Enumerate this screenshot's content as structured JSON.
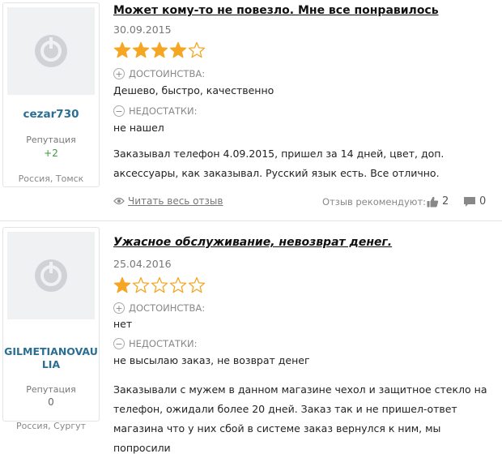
{
  "colors": {
    "username": "#2a6f93",
    "reputation_positive": "#3a9d3a",
    "star": "#f5a623",
    "muted": "#888888"
  },
  "labels": {
    "reputation": "Репутация",
    "pros": "ДОСТОИНСТВА:",
    "cons": "НЕДОСТАТКИ:",
    "read_full": "Читать весь отзыв",
    "recommended": "Отзыв рекомендуют:"
  },
  "reviews": [
    {
      "user": {
        "name": "cezar730",
        "reputation": "+2",
        "location": "Россия, Томск",
        "avatar_icon": "default-avatar-icon"
      },
      "title": "Может кому-то не повезло. Мне все понравилось",
      "date": "30.09.2015",
      "rating": 4,
      "rating_max": 5,
      "pros": "Дешево, быстро, качественно",
      "cons": "не нашел",
      "text_lines": [
        "Заказывал телефон 4.09.2015, пришел за 14 дней, цвет, доп.",
        "аксессуары, как заказывал. Русский язык есть. Все отлично."
      ],
      "likes": "2",
      "comments": "0"
    },
    {
      "user": {
        "name_lines": [
          "GILMETIANOVAU",
          "LIA"
        ],
        "reputation": "0",
        "location": "Россия, Сургут",
        "avatar_icon": "default-avatar-icon"
      },
      "title": "Ужасное обслуживание, невозврат денег.",
      "date": "25.04.2016",
      "rating": 1,
      "rating_max": 5,
      "pros": "нет",
      "cons": "не высылаю заказ, не возврат денег",
      "text_lines": [
        "Заказывали с мужем в данном магазине чехол и защитное стекло на",
        "телефон, ожидали более 20 дней. Заказ так и не пришел-ответ",
        "магазина что у них сбой в системе заказ вернулся к ним, мы попросили"
      ]
    }
  ]
}
